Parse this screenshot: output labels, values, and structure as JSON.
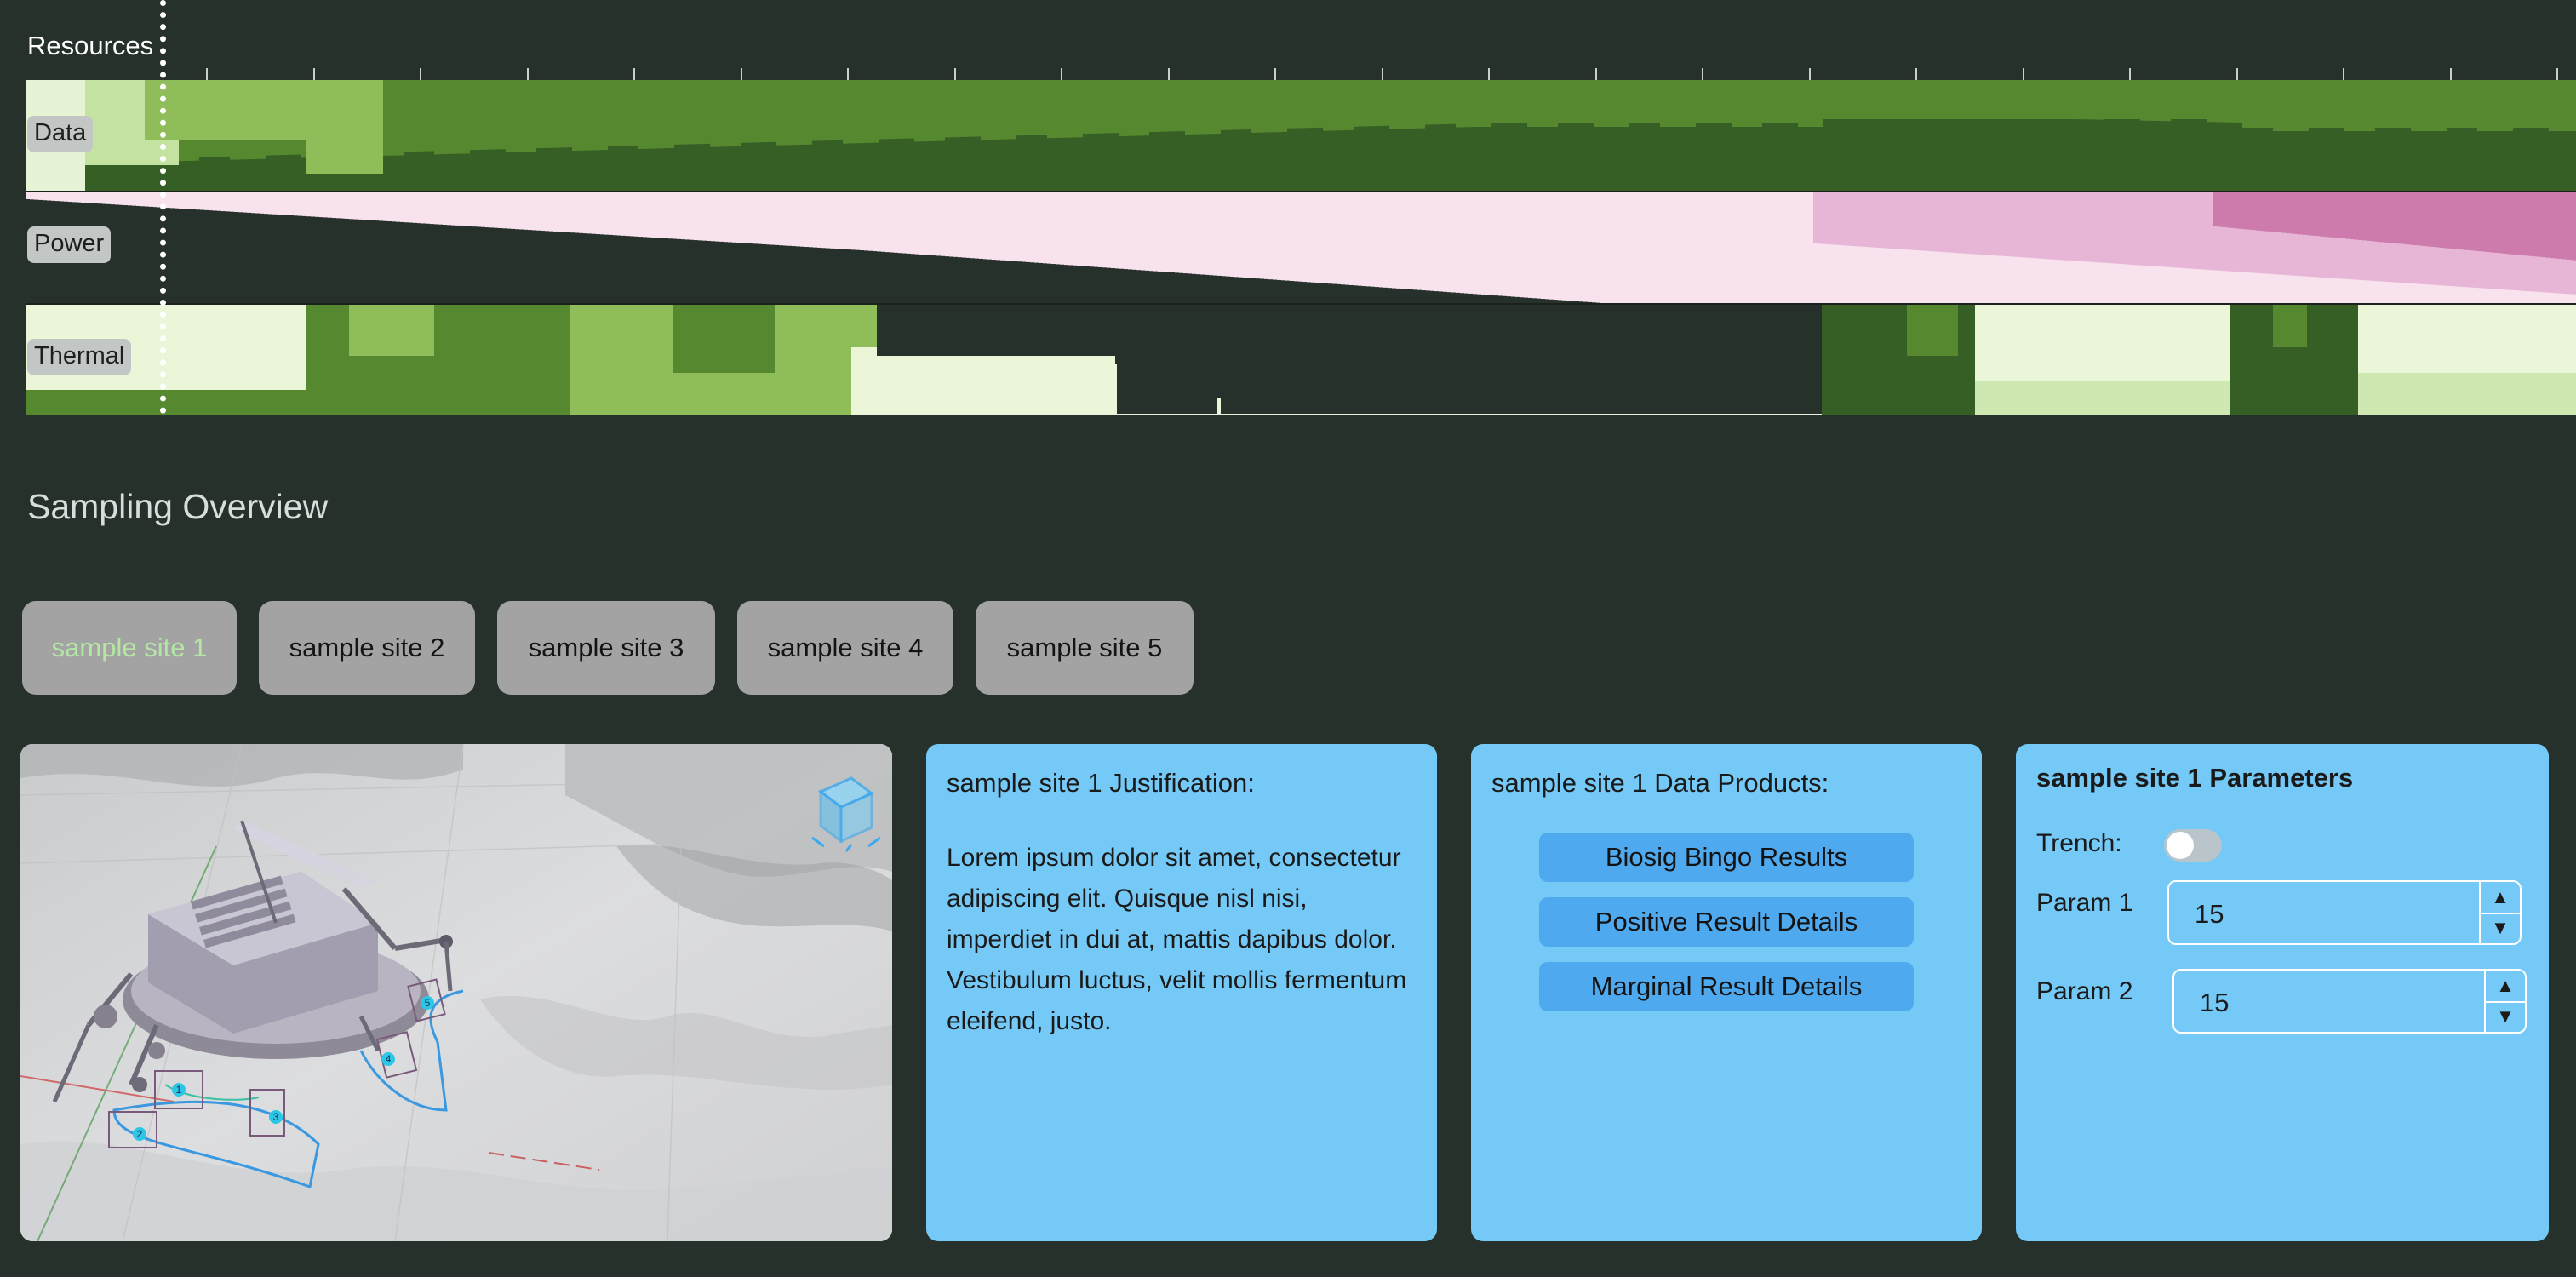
{
  "resources": {
    "title": "Resources",
    "tracks": {
      "data": {
        "label": "Data"
      },
      "power": {
        "label": "Power"
      },
      "thermal": {
        "label": "Thermal"
      }
    }
  },
  "sampling": {
    "title": "Sampling Overview",
    "tabs": [
      {
        "label": "sample site 1",
        "active": true
      },
      {
        "label": "sample site 2",
        "active": false
      },
      {
        "label": "sample site 3",
        "active": false
      },
      {
        "label": "sample site 4",
        "active": false
      },
      {
        "label": "sample site 5",
        "active": false
      }
    ],
    "viewport": {
      "markers": [
        "1",
        "2",
        "3",
        "4",
        "5"
      ]
    },
    "justification": {
      "heading": "sample site 1 Justification:",
      "body": "Lorem ipsum dolor sit amet, consectetur adipiscing elit. Quisque nisl nisi, imperdiet in dui at, mattis dapibus dolor. Vestibulum luctus, velit mollis fermentum eleifend, justo."
    },
    "data_products": {
      "heading": "sample site 1 Data Products:",
      "items": [
        "Biosig Bingo Results",
        "Positive Result Details",
        "Marginal Result Details"
      ]
    },
    "parameters": {
      "heading": "sample site 1 Parameters",
      "trench_label": "Trench:",
      "trench_on": false,
      "param1_label": "Param 1",
      "param1_value": "15",
      "param2_label": "Param 2",
      "param2_value": "15"
    }
  },
  "colors": {
    "background": "#27312b",
    "panel": "#74c9f6",
    "tab": "#a3a3a3",
    "tab_active_text": "#b4e6a4",
    "data_dark": "#365f26",
    "data_mid": "#56892f",
    "data_light": "#8fbd5a",
    "data_pale": "#c4e3a0",
    "power_pale": "#f7e2ee",
    "power_mid": "#e7b5d6",
    "power_dark": "#cd7bac",
    "thermal_pale": "#eaf6d7"
  }
}
